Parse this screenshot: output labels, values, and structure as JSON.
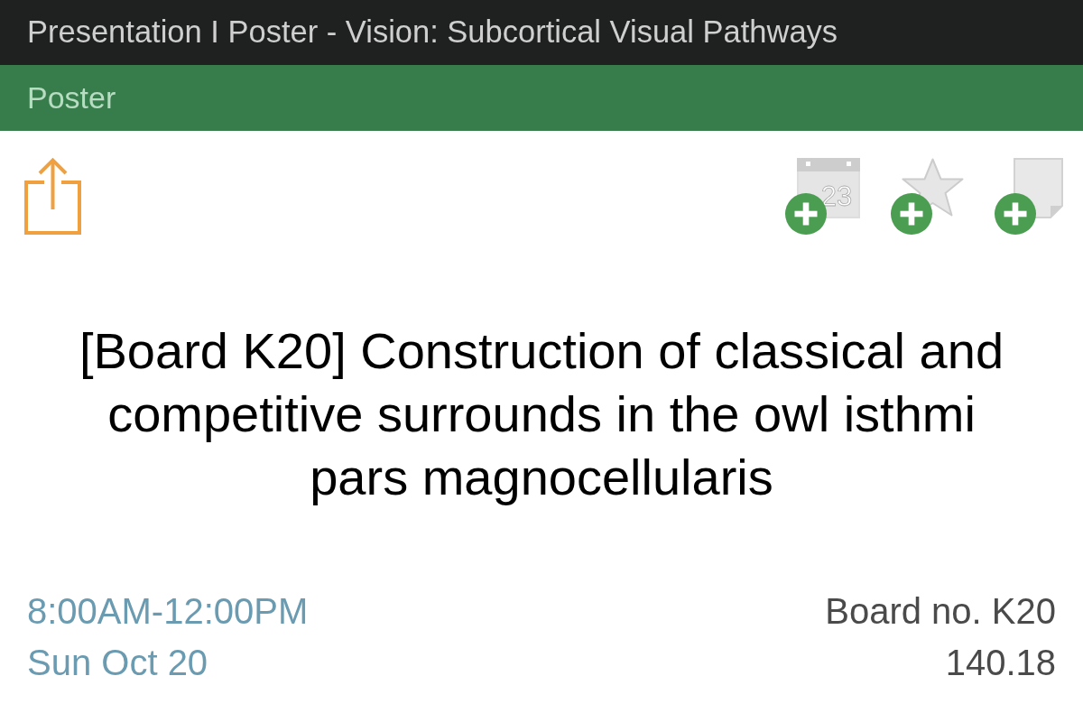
{
  "header": {
    "title": "Presentation I Poster - Vision: Subcortical Visual Pathways"
  },
  "category_bar": {
    "label": "Poster"
  },
  "actions": [
    {
      "kind": "calendar",
      "day": "23"
    },
    {
      "kind": "favorite"
    },
    {
      "kind": "note"
    }
  ],
  "poster": {
    "title": "[Board K20] Construction of classical and competitive surrounds in the owl isthmi pars magnocellularis",
    "time": "8:00AM-12:00PM",
    "date": "Sun Oct 20",
    "board": "Board no. K20",
    "number": "140.18"
  }
}
